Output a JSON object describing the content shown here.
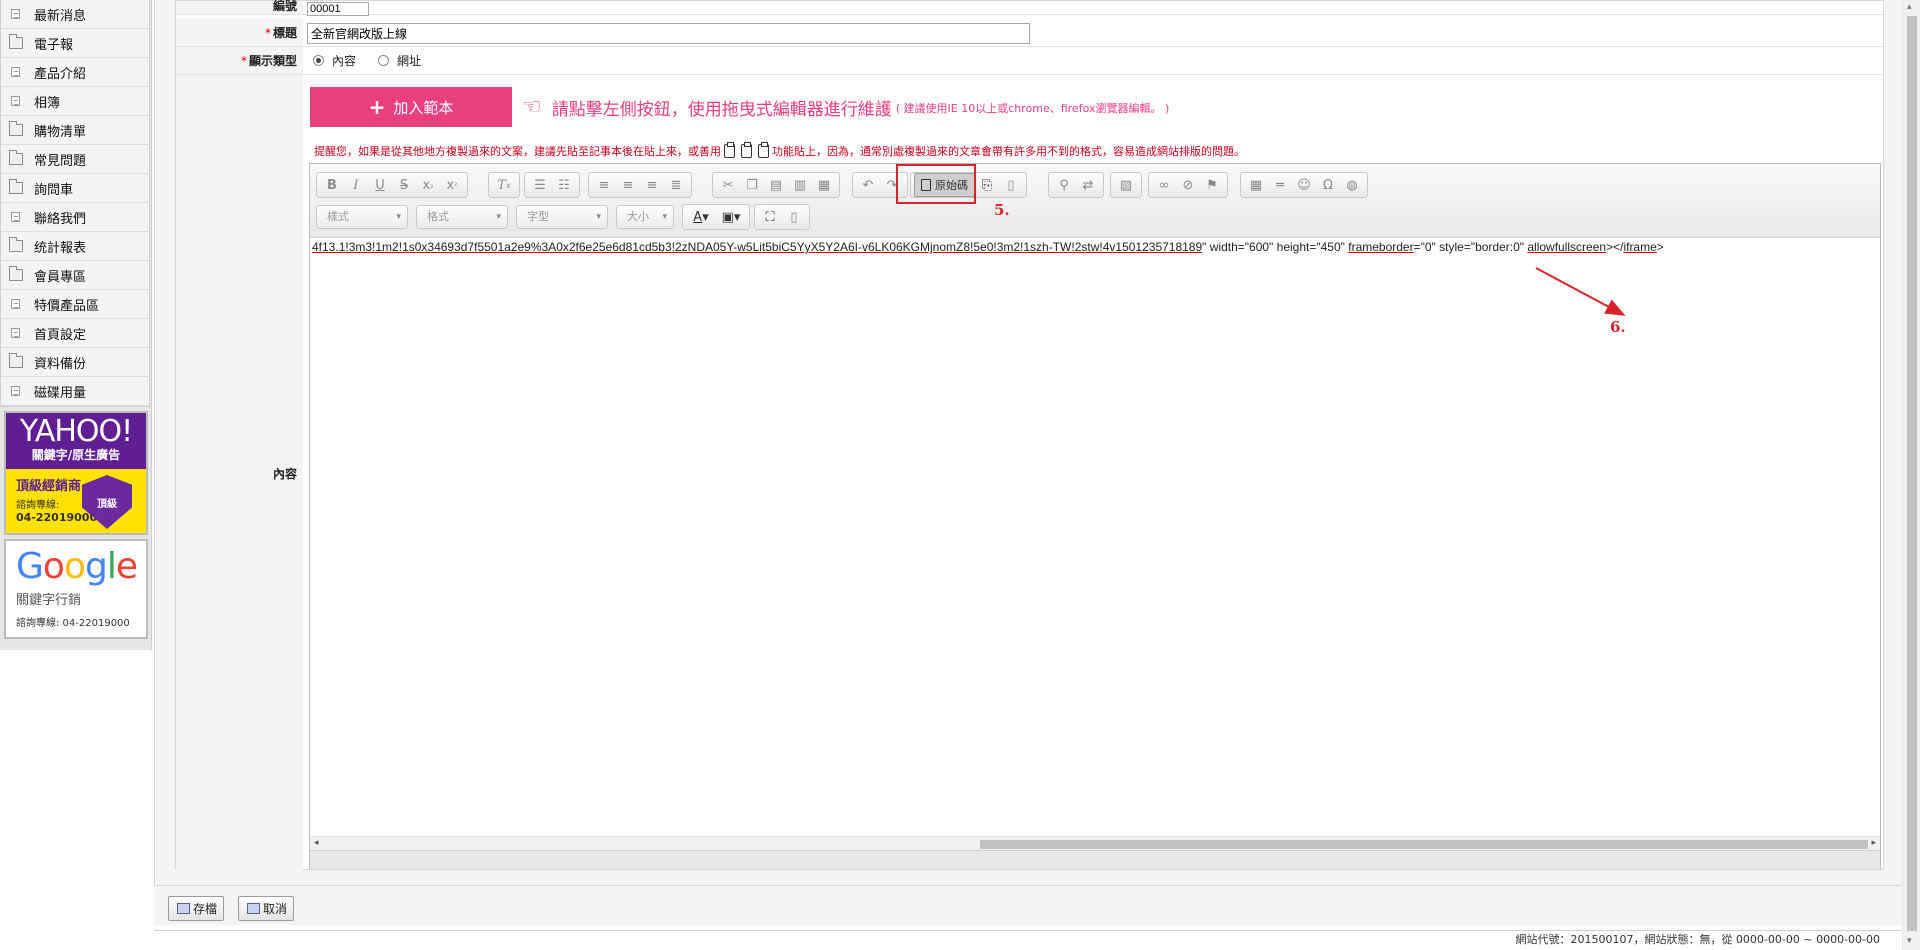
{
  "sidebar": {
    "items": [
      {
        "label": "最新消息",
        "icon": "doc-icon"
      },
      {
        "label": "電子報",
        "icon": "folder-icon"
      },
      {
        "label": "產品介紹",
        "icon": "doc-icon"
      },
      {
        "label": "相簿",
        "icon": "doc-icon"
      },
      {
        "label": "購物清單",
        "icon": "folder-icon"
      },
      {
        "label": "常見問題",
        "icon": "folder-icon"
      },
      {
        "label": "詢問車",
        "icon": "folder-icon"
      },
      {
        "label": "聯絡我們",
        "icon": "doc-icon"
      },
      {
        "label": "统計報表",
        "icon": "folder-icon"
      },
      {
        "label": "會員專區",
        "icon": "folder-icon"
      },
      {
        "label": "特價產品區",
        "icon": "doc-icon"
      },
      {
        "label": "首頁設定",
        "icon": "doc-icon"
      },
      {
        "label": "資料備份",
        "icon": "folder-icon"
      },
      {
        "label": "磁碟用量",
        "icon": "doc-icon"
      }
    ],
    "yahoo_ad": {
      "logo": "YAHOO!",
      "subtitle": "關鍵字/原生廣告",
      "level": "頂級經銷商",
      "tel_label": "諮詢專線:",
      "tel": "04-22019000",
      "badge": "頂級"
    },
    "google_ad": {
      "logo": [
        "G",
        "o",
        "o",
        "g",
        "l",
        "e"
      ],
      "subtitle": "關鍵字行銷",
      "tel": "諮詢專線: 04-22019000"
    }
  },
  "form": {
    "code": {
      "label": "編號",
      "value": "00001"
    },
    "title": {
      "label": "標題",
      "value": "全新官網改版上線"
    },
    "display_type": {
      "label": "顯示類型",
      "options": [
        "內容",
        "網址"
      ],
      "selected": "內容"
    },
    "content": {
      "label": "內容"
    }
  },
  "template": {
    "add_button": "加入範本",
    "hint_main": "請點擊左側按鈕，使用拖曳式編輯器進行維護",
    "hint_sub": "( 建議使用IE 10以上或chrome、firefox瀏覽器編輯。 )"
  },
  "warning": {
    "before": "提醒您，如果是從其他地方複製過來的文案，建議先貼至記事本後在貼上來，或善用",
    "after": "功能貼上，因為，通常別處複製過來的文章會帶有許多用不到的格式，容易造成網站排版的問題。"
  },
  "editor": {
    "source_button": "原始碼",
    "combos": [
      "樣式",
      "格式",
      "字型",
      "大小"
    ],
    "source_text": {
      "part1": "4f13.1",
      "part2": "!3m3!1m2!1s0x34693d7f5501a2e9%3A0x2f6e25e6d81cd5b3!2zNDA05Y-w5Lit5biC5YyX5Y2A6I-v6LK06KGMjnomZ8!5e0!3m2!1szh-TW!2stw!4v1501235718189",
      "part3": "\" width=\"600\" height=\"450\" ",
      "part4": "frameborder",
      "part5": "=\"0\" style=\"border:0\" ",
      "part6": "allowfullscreen",
      "part7": "></",
      "part8": "iframe",
      "part9": ">"
    }
  },
  "annotations": {
    "step5": "5.",
    "step6": "6.",
    "color": "#d8232a"
  },
  "actions": {
    "save": "存檔",
    "cancel": "取消"
  },
  "status": "網站代號：201500107，網站狀態：無，從 0000-00-00 ~ 0000-00-00"
}
